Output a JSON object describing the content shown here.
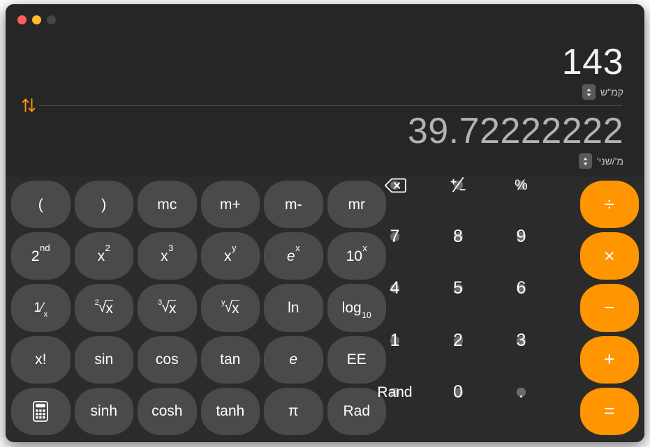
{
  "window": {
    "title": "Calculator",
    "traffic_lights": [
      {
        "name": "close",
        "color": "#ff5f57"
      },
      {
        "name": "minimize",
        "color": "#febc2e"
      },
      {
        "name": "zoom",
        "color": "#454545"
      }
    ],
    "accent_color": "#ff9500",
    "background": "#262626",
    "keypad_background": "#2b2b2b"
  },
  "display": {
    "primary": {
      "value": "143",
      "unit": "קמ\"ש",
      "stepper": "stepper-up-down-icon"
    },
    "secondary": {
      "value": "39.72222222",
      "unit": "מ'/שני'",
      "stepper": "stepper-up-down-icon"
    },
    "swap": {
      "icon": "swap-arrows-icon",
      "color": "#ff9500"
    }
  },
  "keypad": {
    "rows": [
      [
        {
          "id": "open-paren",
          "label": "(",
          "style": "func",
          "kind": "text"
        },
        {
          "id": "close-paren",
          "label": ")",
          "style": "func",
          "kind": "text"
        },
        {
          "id": "mc",
          "label": "mc",
          "style": "func",
          "kind": "text"
        },
        {
          "id": "m-plus",
          "label": "m+",
          "style": "func",
          "kind": "text"
        },
        {
          "id": "m-minus",
          "label": "m-",
          "style": "func",
          "kind": "text"
        },
        {
          "id": "mr",
          "label": "mr",
          "style": "func",
          "kind": "text"
        },
        {
          "id": "delete",
          "label": "",
          "style": "light",
          "kind": "icon",
          "icon": "backspace-icon"
        },
        {
          "id": "sign-toggle",
          "label": "+/-",
          "style": "light",
          "kind": "icon",
          "icon": "plus-minus-icon"
        },
        {
          "id": "percent",
          "label": "%",
          "style": "light",
          "kind": "text"
        },
        {
          "id": "divide",
          "label": "÷",
          "style": "accent",
          "kind": "op"
        }
      ],
      [
        {
          "id": "second",
          "label": "2nd",
          "style": "func",
          "kind": "sup",
          "base": "2",
          "sup": "nd"
        },
        {
          "id": "x-square",
          "label": "x²",
          "style": "func",
          "kind": "sup",
          "base": "x",
          "sup": "2"
        },
        {
          "id": "x-cube",
          "label": "x³",
          "style": "func",
          "kind": "sup",
          "base": "x",
          "sup": "3"
        },
        {
          "id": "x-power-y",
          "label": "xʸ",
          "style": "func",
          "kind": "sup",
          "base": "x",
          "sup": "y"
        },
        {
          "id": "e-power-x",
          "label": "eˣ",
          "style": "func",
          "kind": "supi",
          "base": "e",
          "sup": "x"
        },
        {
          "id": "ten-power-x",
          "label": "10ˣ",
          "style": "func",
          "kind": "sup",
          "base": "10",
          "sup": "x"
        },
        {
          "id": "digit-7",
          "label": "7",
          "style": "light",
          "kind": "num"
        },
        {
          "id": "digit-8",
          "label": "8",
          "style": "light",
          "kind": "num"
        },
        {
          "id": "digit-9",
          "label": "9",
          "style": "light",
          "kind": "num"
        },
        {
          "id": "multiply",
          "label": "×",
          "style": "accent",
          "kind": "op"
        }
      ],
      [
        {
          "id": "reciprocal",
          "label": "1/x",
          "style": "func",
          "kind": "frac",
          "base": "⅟",
          "sub": "x"
        },
        {
          "id": "square-root",
          "label": "²√x",
          "style": "func",
          "kind": "root",
          "index": "2",
          "radicand": "x"
        },
        {
          "id": "cube-root",
          "label": "³√x",
          "style": "func",
          "kind": "root",
          "index": "3",
          "radicand": "x"
        },
        {
          "id": "y-root",
          "label": "ʸ√x",
          "style": "func",
          "kind": "root",
          "index": "y",
          "radicand": "x"
        },
        {
          "id": "natural-log",
          "label": "ln",
          "style": "func",
          "kind": "text"
        },
        {
          "id": "log-base-10",
          "label": "log10",
          "style": "func",
          "kind": "sub",
          "base": "log",
          "sub": "10"
        },
        {
          "id": "digit-4",
          "label": "4",
          "style": "light",
          "kind": "num"
        },
        {
          "id": "digit-5",
          "label": "5",
          "style": "light",
          "kind": "num"
        },
        {
          "id": "digit-6",
          "label": "6",
          "style": "light",
          "kind": "num"
        },
        {
          "id": "subtract",
          "label": "−",
          "style": "accent",
          "kind": "op"
        }
      ],
      [
        {
          "id": "factorial",
          "label": "x!",
          "style": "func",
          "kind": "text"
        },
        {
          "id": "sin",
          "label": "sin",
          "style": "func",
          "kind": "text"
        },
        {
          "id": "cos",
          "label": "cos",
          "style": "func",
          "kind": "text"
        },
        {
          "id": "tan",
          "label": "tan",
          "style": "func",
          "kind": "text"
        },
        {
          "id": "euler-e",
          "label": "e",
          "style": "func",
          "kind": "ital"
        },
        {
          "id": "ee",
          "label": "EE",
          "style": "func",
          "kind": "text"
        },
        {
          "id": "digit-1",
          "label": "1",
          "style": "light",
          "kind": "num"
        },
        {
          "id": "digit-2",
          "label": "2",
          "style": "light",
          "kind": "num"
        },
        {
          "id": "digit-3",
          "label": "3",
          "style": "light",
          "kind": "num"
        },
        {
          "id": "add",
          "label": "+",
          "style": "accent",
          "kind": "op"
        }
      ],
      [
        {
          "id": "basic-calculator",
          "label": "",
          "style": "func",
          "kind": "icon",
          "icon": "calculator-icon"
        },
        {
          "id": "sinh",
          "label": "sinh",
          "style": "func",
          "kind": "text"
        },
        {
          "id": "cosh",
          "label": "cosh",
          "style": "func",
          "kind": "text"
        },
        {
          "id": "tanh",
          "label": "tanh",
          "style": "func",
          "kind": "text"
        },
        {
          "id": "pi",
          "label": "π",
          "style": "func",
          "kind": "text"
        },
        {
          "id": "rad",
          "label": "Rad",
          "style": "func",
          "kind": "text"
        },
        {
          "id": "rand",
          "label": "Rand",
          "style": "light",
          "kind": "text"
        },
        {
          "id": "digit-0",
          "label": "0",
          "style": "light",
          "kind": "num"
        },
        {
          "id": "decimal",
          "label": ".",
          "style": "light",
          "kind": "num"
        },
        {
          "id": "equals",
          "label": "=",
          "style": "accent",
          "kind": "op"
        }
      ]
    ]
  }
}
